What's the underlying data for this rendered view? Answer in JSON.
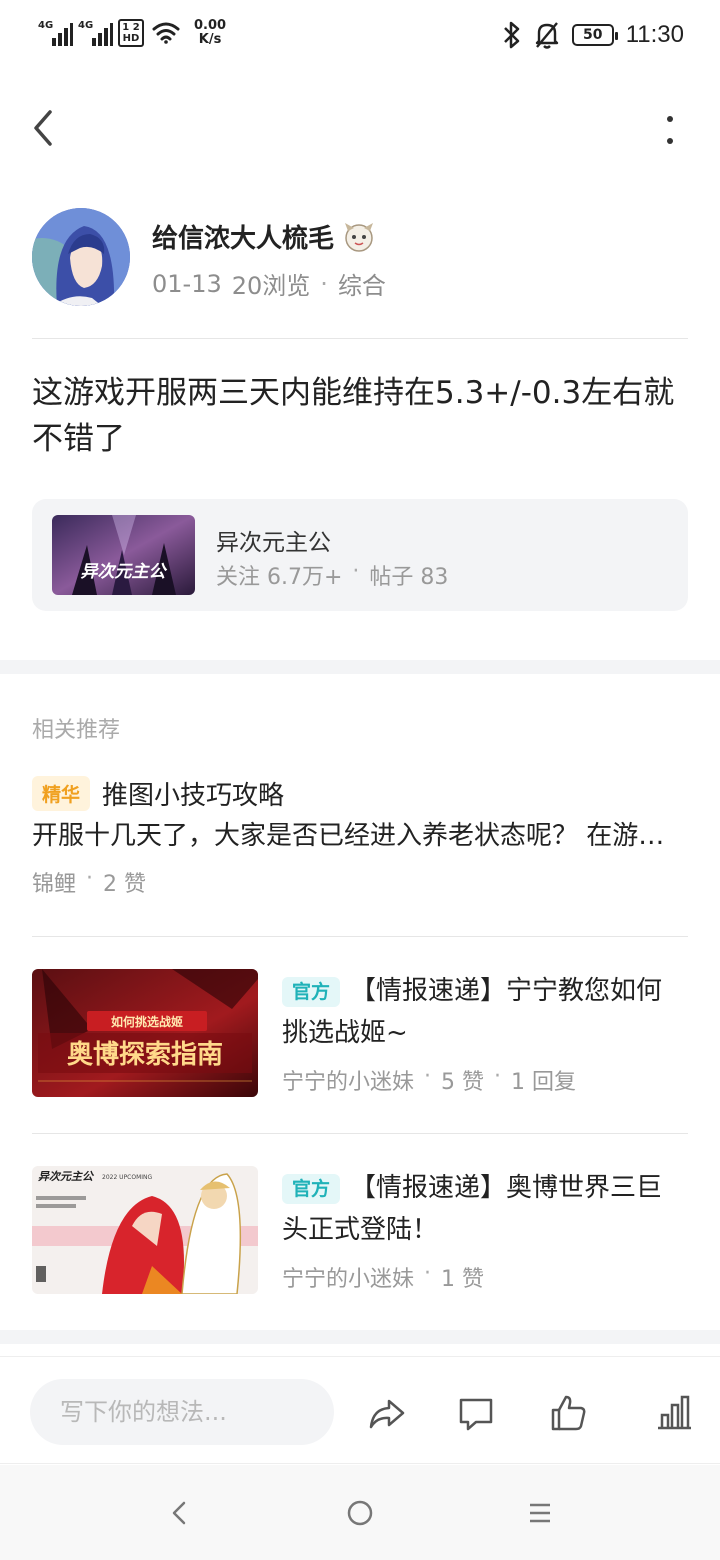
{
  "status_bar": {
    "signal1_tag": "4G",
    "signal2_tag": "4G",
    "hd_label": "1 2\nHD",
    "net_speed_value": "0.00",
    "net_speed_unit": "K/s",
    "battery": "50",
    "time": "11:30"
  },
  "post": {
    "author_name": "给信浓大人梳毛",
    "date": "01-13",
    "views": "20浏览",
    "category": "综合",
    "text": "这游戏开服两三天内能维持在5.3+/-0.3左右就不错了"
  },
  "forum": {
    "thumb_logo": "异次元主公",
    "name": "异次元主公",
    "follow_text": "关注 6.7万+",
    "posts_text": "帖子 83"
  },
  "related": {
    "heading": "相关推荐",
    "items": [
      {
        "badge": "精华",
        "title": "推图小技巧攻略",
        "snippet": "开服十几天了，大家是否已经进入养老状态呢？ 在游戏中体验到的推图小技巧分享给大家",
        "author": "锦鲤",
        "likes": "2 赞"
      },
      {
        "badge": "官方",
        "title": "【情报速递】宁宁教您如何挑选战姬~",
        "thumb_small": "如何挑选战姬",
        "thumb_big": "奥博探索指南",
        "author": "宁宁的小迷妹",
        "likes": "5 赞",
        "replies": "1 回复"
      },
      {
        "badge": "官方",
        "title": "【情报速递】奥博世界三巨头正式登陆！",
        "thumb_logo": "异次元主公",
        "thumb_tag": "2022 UPCOMING",
        "author": "宁宁的小迷妹",
        "likes": "1 赞"
      }
    ]
  },
  "action_bar": {
    "comment_placeholder": "写下你的想法..."
  },
  "colors": {
    "accent_gold": "#f0a020",
    "accent_teal": "#20b2b8",
    "muted_text": "#999999",
    "card_bg": "#f3f4f6"
  }
}
